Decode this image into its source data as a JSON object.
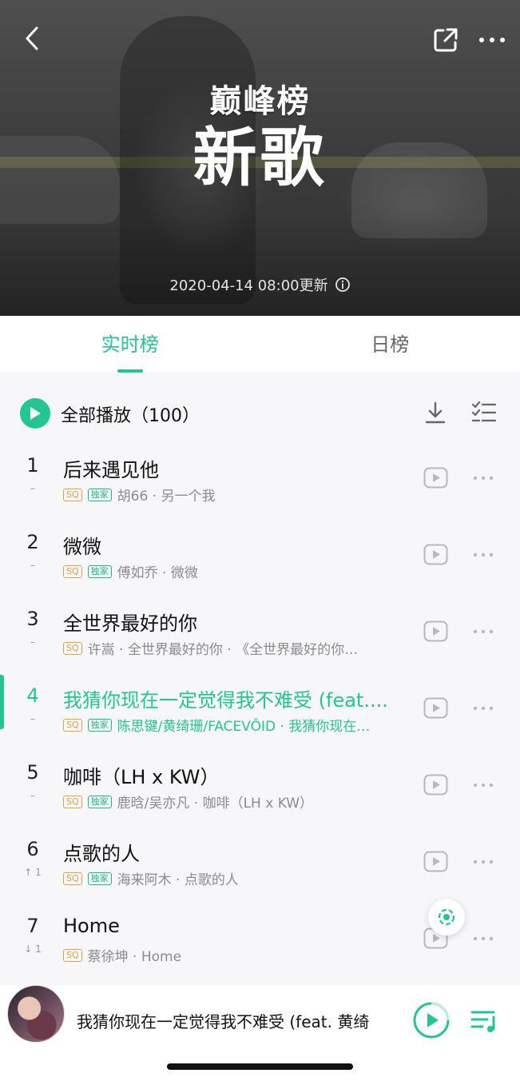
{
  "header": {
    "logo_text": "巅峰榜",
    "title": "新歌",
    "update_time": "2020-04-14  08:00更新"
  },
  "tabs": [
    {
      "label": "实时榜",
      "active": true
    },
    {
      "label": "日榜",
      "active": false
    }
  ],
  "play_all": {
    "label": "全部播放（100）"
  },
  "songs": [
    {
      "rank": "1",
      "trend": "–",
      "title": "后来遇见他",
      "sq": "SQ",
      "exclusive": "独家",
      "meta": "胡66 · 另一个我"
    },
    {
      "rank": "2",
      "trend": "–",
      "title": "微微",
      "sq": "SQ",
      "exclusive": "独家",
      "meta": "傅如乔 · 微微"
    },
    {
      "rank": "3",
      "trend": "–",
      "title": "全世界最好的你",
      "sq": "SQ",
      "exclusive": null,
      "meta": "许嵩 · 全世界最好的你 · 《全世界最好的你…"
    },
    {
      "rank": "4",
      "trend": "–",
      "title": "我猜你现在一定觉得我不难受 (feat....",
      "sq": "SQ",
      "exclusive": "独家",
      "meta": "陈思键/黄绮珊/FACEVÔID · 我猜你现在…",
      "current": true
    },
    {
      "rank": "5",
      "trend": "–",
      "title": "咖啡（LH x KW）",
      "sq": "SQ",
      "exclusive": "独家",
      "meta": "鹿晗/吴亦凡 · 咖啡（LH x KW）"
    },
    {
      "rank": "6",
      "trend": "↑ 1",
      "title": "点歌的人",
      "sq": "SQ",
      "exclusive": "独家",
      "meta": "海来阿木 · 点歌的人"
    },
    {
      "rank": "7",
      "trend": "↓ 1",
      "title": "Home",
      "sq": "SQ",
      "exclusive": null,
      "meta": "蔡徐坤 · Home"
    }
  ],
  "player": {
    "now_playing": "我猜你现在一定觉得我不难受 (feat. 黄绮"
  },
  "colors": {
    "accent": "#22c78f",
    "sq_badge": "#e7a23a"
  }
}
